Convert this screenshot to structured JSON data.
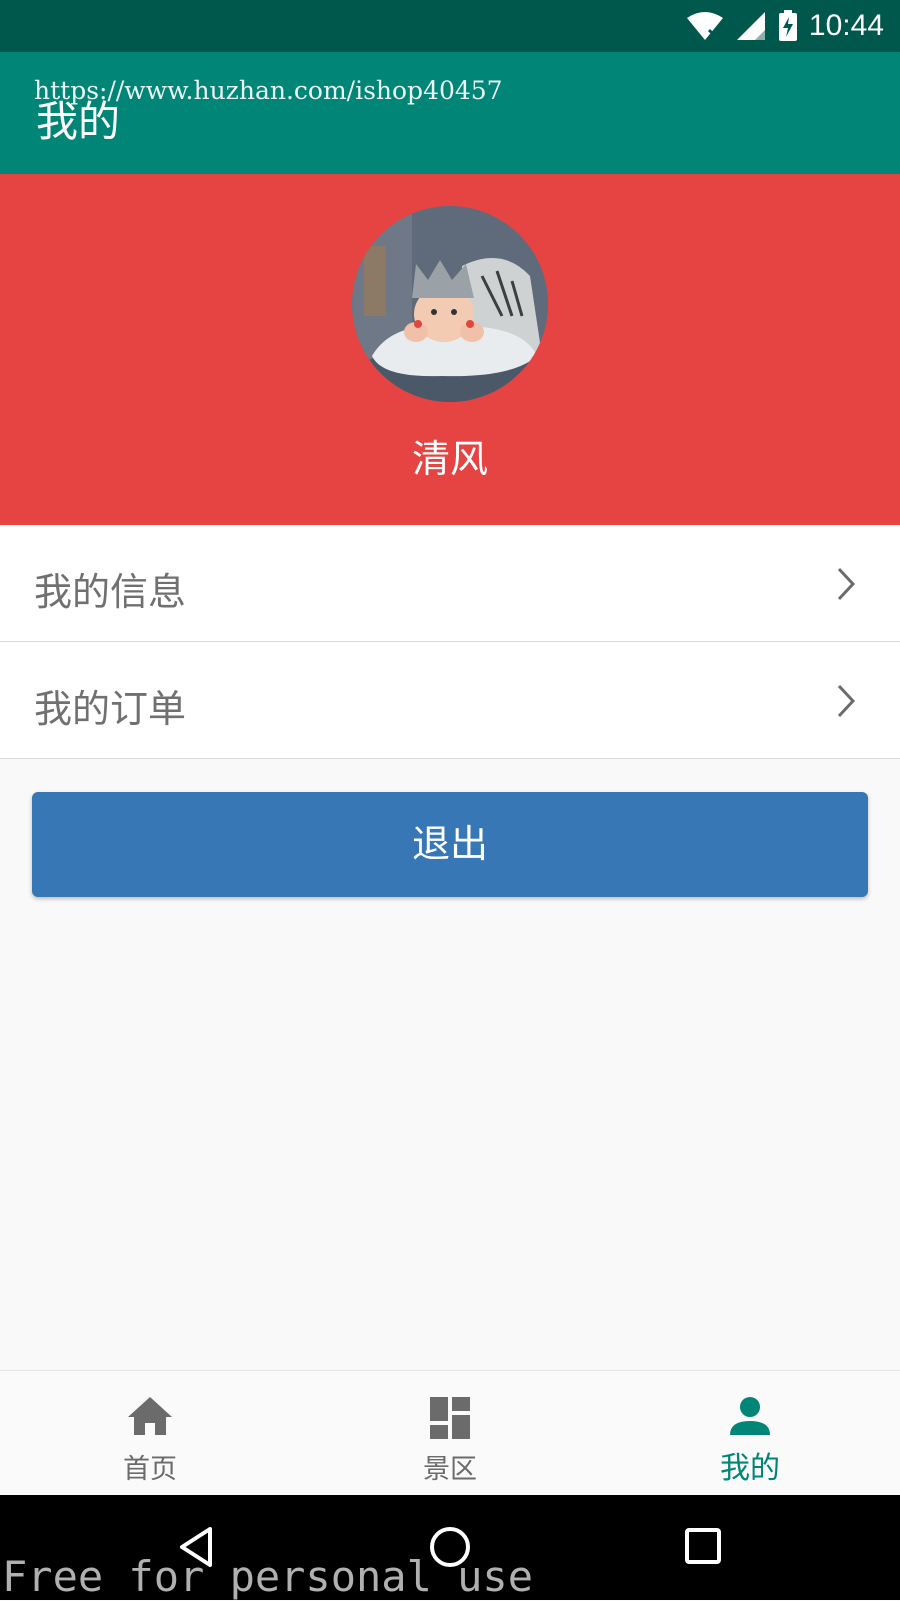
{
  "status_bar": {
    "time": "10:44",
    "icons": [
      "wifi-icon",
      "signal-icon",
      "battery-charging-icon"
    ]
  },
  "app_bar": {
    "title": "我的",
    "watermark_url": "https://www.huzhan.com/ishop40457"
  },
  "profile": {
    "username": "清风",
    "avatar": "baby-photo-avatar",
    "header_color": "#e64343"
  },
  "menu": {
    "items": [
      {
        "label": "我的信息",
        "icon": "chevron-right-icon"
      },
      {
        "label": "我的订单",
        "icon": "chevron-right-icon"
      }
    ]
  },
  "logout": {
    "label": "退出",
    "color": "#3777b5"
  },
  "bottom_nav": {
    "items": [
      {
        "label": "首页",
        "icon": "home-icon",
        "active": false
      },
      {
        "label": "景区",
        "icon": "dashboard-icon",
        "active": false
      },
      {
        "label": "我的",
        "icon": "person-icon",
        "active": true
      }
    ],
    "active_color": "#008577"
  },
  "system_nav": {
    "icons": [
      "back-icon",
      "home-circle-icon",
      "recents-icon"
    ]
  },
  "watermark": {
    "footer_text": "Free for personal use"
  },
  "colors": {
    "primary": "#008577",
    "primary_dark": "#00574b"
  }
}
